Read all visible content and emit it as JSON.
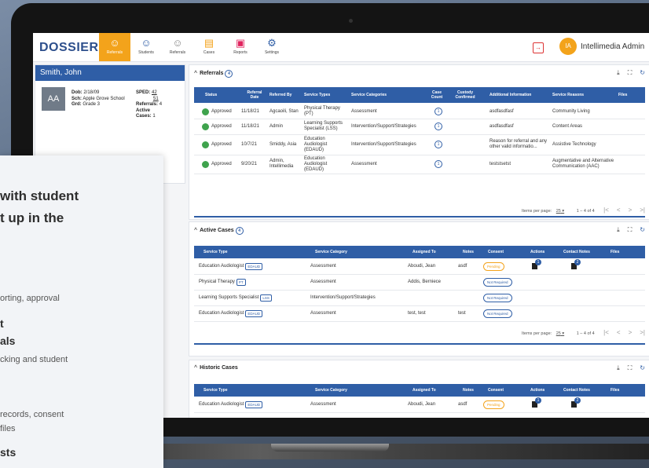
{
  "app": {
    "logo": "DOSSIER",
    "nav": [
      {
        "label": "Referrals",
        "icon": "people-icon",
        "active": true
      },
      {
        "label": "Students",
        "icon": "students-icon",
        "active": false
      },
      {
        "label": "Referrals",
        "icon": "referrals-icon",
        "active": false
      },
      {
        "label": "Cases",
        "icon": "folder-icon",
        "active": false
      },
      {
        "label": "Reports",
        "icon": "report-icon",
        "active": false
      },
      {
        "label": "Settings",
        "icon": "gear-icon",
        "active": false
      }
    ],
    "user": {
      "initials": "IA",
      "name": "Intellimedia Admin"
    }
  },
  "student": {
    "name": "Smith, John",
    "initials": "AA",
    "dob_label": "Dob:",
    "dob": "2/18/09",
    "sch_label": "Sch:",
    "school": "Apple Grove School",
    "grd_label": "Grd:",
    "grade": "Grade 3",
    "sped_label": "SPED:",
    "sped1": "42",
    "sped2": "51",
    "referrals_label": "Referrals:",
    "referrals": "4",
    "active_label": "Active",
    "cases_label": "Cases:",
    "cases": "1"
  },
  "overlay": {
    "line1": "with student",
    "line2": "t up in the",
    "line3": "orting, approval",
    "line4": "t",
    "line5": "als",
    "line6": "cking and student",
    "line7": "records, consent",
    "line8": "files",
    "line9": "sts"
  },
  "referrals": {
    "title": "Referrals",
    "count": "4",
    "columns": [
      "Status",
      "Referral Date",
      "Referred By",
      "Service Types",
      "Service Categories",
      "Case Count",
      "Custody Confirmed",
      "Additional Information",
      "Service Reasons",
      "Files"
    ],
    "rows": [
      {
        "status": "Approved",
        "date": "11/18/21",
        "by": "Agcaoili, Stan",
        "type": "Physical Therapy (PT)",
        "category": "Assessment",
        "count": "1",
        "info": "asdfasdfasf",
        "reason": "Community Living"
      },
      {
        "status": "Approved",
        "date": "11/18/21",
        "by": "Admin",
        "type": "Learning Supports Specialist (LSS)",
        "category": "Intervention/Support/Strategies",
        "count": "1",
        "info": "asdfasdfasf",
        "reason": "Content Areas"
      },
      {
        "status": "Approved",
        "date": "10/7/21",
        "by": "Smiddy, Asia",
        "type": "Education Audiologist (EDAUD)",
        "category": "Intervention/Support/Strategies",
        "count": "1",
        "info": "Reason for referral and any other valid informatio...",
        "reason": "Assistive Technology"
      },
      {
        "status": "Approved",
        "date": "9/20/21",
        "by": "Admin, Intellimedia",
        "type": "Education Audiologist (EDAUD)",
        "category": "Assessment",
        "count": "1",
        "info": "teststsetst",
        "reason": "Augmentative and Alternative Communication (AAC)"
      }
    ],
    "pager": {
      "label": "Items per page:",
      "size": "25",
      "range": "1 – 4 of 4"
    }
  },
  "active_cases": {
    "title": "Active Cases",
    "count": "4",
    "columns": [
      "Service Type",
      "Service Category",
      "Assigned To",
      "Notes",
      "Consent",
      "Actions",
      "Contact Notes",
      "Files"
    ],
    "rows": [
      {
        "type": "Education Audiologist",
        "tag": "EDAUD",
        "category": "Assessment",
        "assigned": "Aboudi, Jean",
        "notes": "asdf",
        "consent": "Pending",
        "actions": "1",
        "contact": "2"
      },
      {
        "type": "Physical Therapy",
        "tag": "PT",
        "category": "Assessment",
        "assigned": "Addis, Berniece",
        "notes": "",
        "consent": "Not Required",
        "actions": "",
        "contact": ""
      },
      {
        "type": "Learning Supports Specialist",
        "tag": "LSS",
        "category": "Intervention/Support/Strategies",
        "assigned": "",
        "notes": "",
        "consent": "Not Required",
        "actions": "",
        "contact": ""
      },
      {
        "type": "Education Audiologist",
        "tag": "EDAUD",
        "category": "Assessment",
        "assigned": "test, test",
        "notes": "test",
        "consent": "Not Required",
        "actions": "",
        "contact": ""
      }
    ],
    "pager": {
      "label": "Items per page:",
      "size": "25",
      "range": "1 – 4 of 4"
    }
  },
  "historic_cases": {
    "title": "Historic Cases",
    "columns": [
      "Service Type",
      "Service Category",
      "Assigned To",
      "Notes",
      "Consent",
      "Actions",
      "Contact Notes",
      "Files"
    ],
    "rows": [
      {
        "type": "Education Audiologist",
        "tag": "EDAUD",
        "category": "Assessment",
        "assigned": "Aboudi, Jean",
        "notes": "asdf",
        "consent": "Pending",
        "actions": "1",
        "contact": "2"
      }
    ]
  },
  "colors": {
    "primary": "#2f5ea6",
    "accent": "#f3a31b",
    "approved": "#3fa34d"
  }
}
